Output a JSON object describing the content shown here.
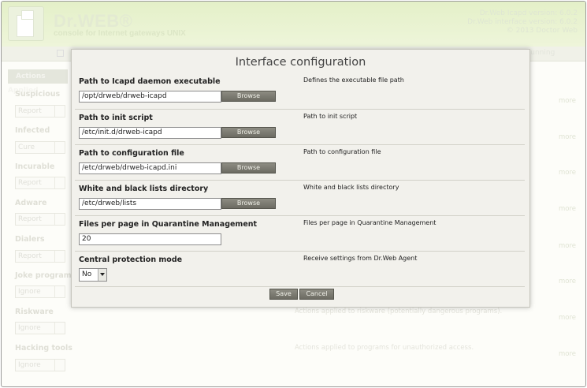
{
  "header": {
    "brand": "Dr.WEB®",
    "tagline": "console for Internet gateways UNIX",
    "icapd_version": "Dr.Web Icapd version: 6.0.2",
    "interface_version": "Dr.Web interface version: 6.0.2",
    "copyright": "© 2013 Doctor Web"
  },
  "menubar": {
    "status_text": "s running"
  },
  "sidebar": {
    "title": "Actions Applied",
    "categories": [
      {
        "label": "Suspicious",
        "value": "Report",
        "more": "more"
      },
      {
        "label": "Infected",
        "value": "Cure",
        "more": "more"
      },
      {
        "label": "Incurable",
        "value": "Report",
        "more": "more"
      },
      {
        "label": "Adware",
        "value": "Report",
        "more": "more"
      },
      {
        "label": "Dialers",
        "value": "Report",
        "more": "more"
      },
      {
        "label": "Joke programs",
        "value": "Ignore",
        "more": "more"
      },
      {
        "label": "Riskware",
        "value": "Ignore",
        "more": "more"
      },
      {
        "label": "Hacking tools",
        "value": "Ignore",
        "more": "more"
      }
    ],
    "desc_riskware": "Actions applied to riskware (potentially dangerous programs).",
    "desc_hacking": "Actions applied to programs for unauthorized access."
  },
  "modal": {
    "title": "Interface configuration",
    "rows": [
      {
        "label": "Path to Icapd daemon executable",
        "description": "Defines the executable file path",
        "value": "/opt/drweb/drweb-icapd",
        "button": "Browse"
      },
      {
        "label": "Path to init script",
        "description": "Path to init script",
        "value": "/etc/init.d/drweb-icapd",
        "button": "Browse"
      },
      {
        "label": "Path to configuration file",
        "description": "Path to configuration file",
        "value": "/etc/drweb/drweb-icapd.ini",
        "button": "Browse"
      },
      {
        "label": "White and black lists directory",
        "description": "White and black lists directory",
        "value": "/etc/drweb/lists",
        "button": "Browse"
      },
      {
        "label": "Files per page in Quarantine Management",
        "description": "Files per page in Quarantine Management",
        "value": "20"
      },
      {
        "label": "Central protection mode",
        "description": "Receive settings from Dr.Web Agent",
        "value": "No"
      }
    ],
    "save_label": "Save",
    "cancel_label": "Cancel"
  }
}
